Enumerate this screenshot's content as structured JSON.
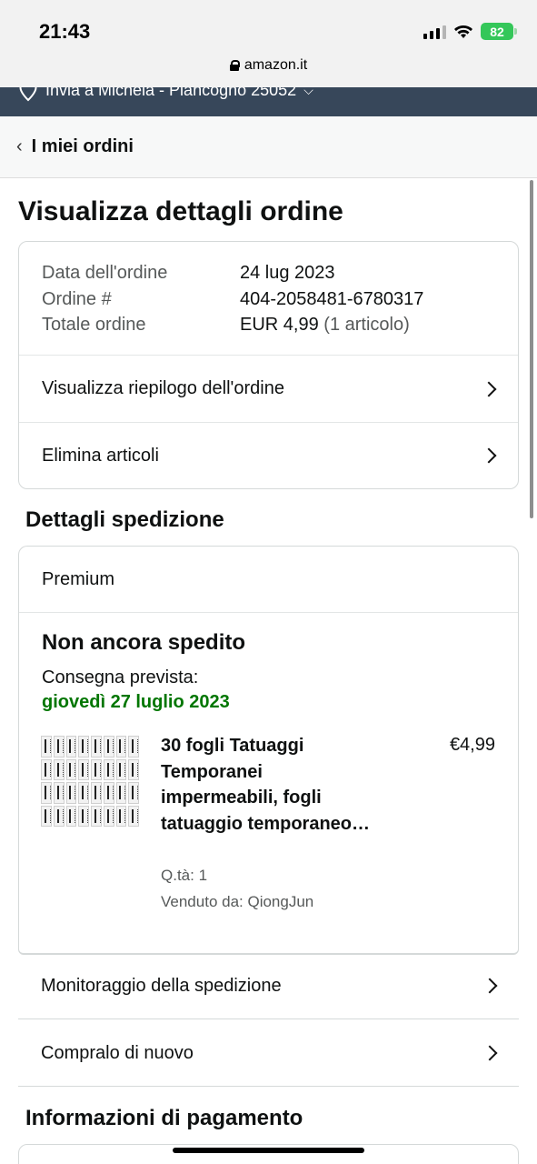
{
  "status_bar": {
    "time": "21:43",
    "battery": "82"
  },
  "browser": {
    "url": "amazon.it"
  },
  "delivery": {
    "text": "Invia a Michela - Piancogno 25052"
  },
  "nav": {
    "back_label": "I miei ordini"
  },
  "page": {
    "title": "Visualizza dettagli ordine"
  },
  "order": {
    "date_label": "Data dell'ordine",
    "date_value": "24 lug 2023",
    "number_label": "Ordine #",
    "number_value": "404-2058481-6780317",
    "total_label": "Totale ordine",
    "total_value": "EUR 4,99",
    "total_items": "(1 articolo)",
    "summary_link": "Visualizza riepilogo dell'ordine",
    "delete_link": "Elimina articoli"
  },
  "shipping": {
    "section_title": "Dettagli spedizione",
    "service": "Premium",
    "status": "Non ancora spedito",
    "expected_label": "Consegna prevista:",
    "expected_date": "giovedì 27 luglio 2023",
    "product": {
      "title": "30 fogli Tatuaggi Temporanei impermeabili, fogli tatuaggio temporaneo…",
      "price": "€4,99",
      "qty": "Q.tà: 1",
      "seller": "Venduto da: QiongJun"
    },
    "tracking_link": "Monitoraggio della spedizione",
    "buy_again_link": "Compralo di nuovo"
  },
  "payment": {
    "section_title": "Informazioni di pagamento"
  },
  "colors": {
    "green": "#007600",
    "nav_dark": "#37475a",
    "battery": "#34c759"
  }
}
